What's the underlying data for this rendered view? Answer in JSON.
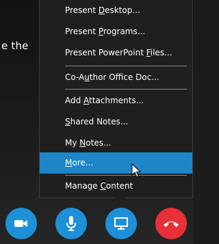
{
  "background": {
    "partial_text": "e the"
  },
  "menu": {
    "items": [
      {
        "pre": "Present ",
        "key": "D",
        "post": "esktop..."
      },
      {
        "pre": "Present ",
        "key": "P",
        "post": "rograms..."
      },
      {
        "pre": "Present PowerPoint ",
        "key": "F",
        "post": "iles..."
      },
      {
        "pre": "Co-A",
        "key": "u",
        "post": "thor Office Doc..."
      },
      {
        "pre": "Add ",
        "key": "A",
        "post": "ttachments..."
      },
      {
        "pre": "",
        "key": "S",
        "post": "hared Notes..."
      },
      {
        "pre": "My ",
        "key": "N",
        "post": "otes..."
      },
      {
        "pre": "",
        "key": "M",
        "post": "ore..."
      },
      {
        "pre": "Manage ",
        "key": "C",
        "post": "ontent"
      }
    ],
    "selected": "More..."
  },
  "controls": {
    "video": "video-camera-icon",
    "audio": "microphone-icon",
    "present": "monitor-icon",
    "hangup": "phone-hangup-icon"
  },
  "colors": {
    "accent": "#1e86c8",
    "button": "#1e90d8",
    "hangup": "#e8303a",
    "menu_bg": "#1f1f1f"
  }
}
